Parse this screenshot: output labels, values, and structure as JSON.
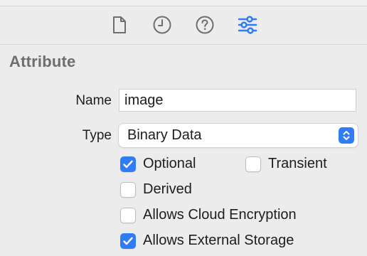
{
  "toolbar": {
    "tabs": [
      {
        "icon": "file-icon",
        "active": false
      },
      {
        "icon": "clock-icon",
        "active": false
      },
      {
        "icon": "help-icon",
        "active": false
      },
      {
        "icon": "sliders-icon",
        "active": true
      }
    ]
  },
  "section": {
    "title": "Attribute"
  },
  "name": {
    "label": "Name",
    "value": "image"
  },
  "type": {
    "label": "Type",
    "value": "Binary Data"
  },
  "options": [
    {
      "label": "Optional",
      "checked": true
    },
    {
      "label": "Transient",
      "checked": false
    },
    {
      "label": "Derived",
      "checked": false
    },
    {
      "label": "Allows Cloud Encryption",
      "checked": false
    },
    {
      "label": "Allows External Storage",
      "checked": true
    }
  ],
  "colors": {
    "accent": "#2f7cf6",
    "inactive_icon": "#6e6e6e",
    "section_title": "#6e6e6e"
  }
}
